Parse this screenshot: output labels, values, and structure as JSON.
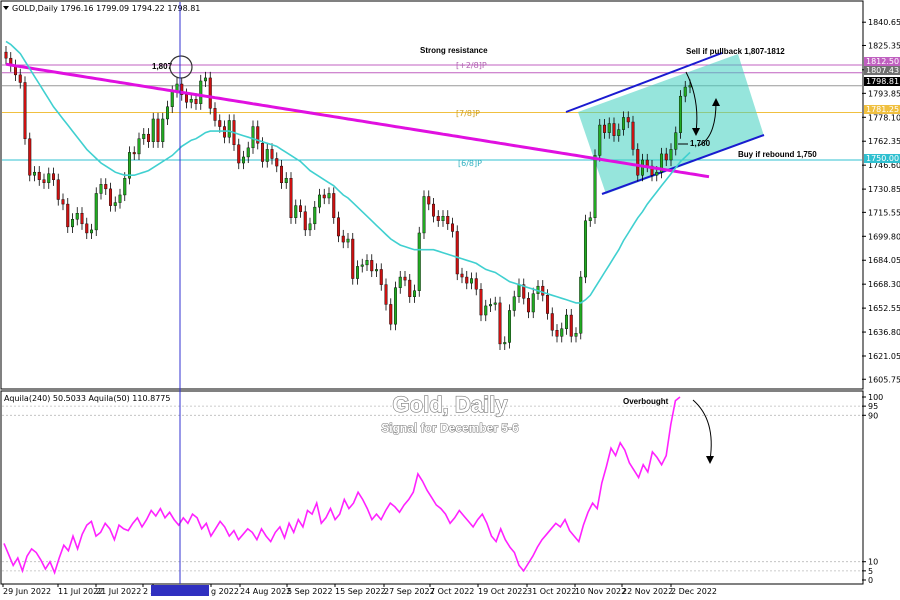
{
  "header": {
    "symbol_text": "GOLD,Daily  1796.16 1799.09 1794.22 1798.81"
  },
  "overlay": {
    "title": "Gold, Daily",
    "subtitle": "Signal for December 5-6"
  },
  "annotations": {
    "strong_resistance": "Strong resistance",
    "sell_note": "Sell if pullback 1,807-1812",
    "buy_note": "Buy if rebound 1,750",
    "level_1760": "1,760",
    "level_1807": "1,807",
    "overbought": "Overbought",
    "murray_top": "[+2/8]P",
    "murray_mid": "[7/8]P",
    "murray_low": "[6/8]P"
  },
  "price_tags": {
    "tag1": "1812.50",
    "tag2": "1807.43",
    "tag3": "1798.81",
    "tag4": "1781.25",
    "tag5": "1750.00"
  },
  "indicator": {
    "label": "Aquila(240) 50.5033  Aquila(50) 110.8775"
  },
  "colors": {
    "bull": "#22aa22",
    "bear": "#cc1111",
    "ma200": "#e010e0",
    "ma21": "#40d0d0",
    "channel": "#1a1ad0",
    "channel_fill": "#40d0c0",
    "oscillator": "#ff22ff"
  },
  "chart_data": [
    {
      "type": "candlestick",
      "title": "GOLD,Daily",
      "ylim": [
        1600,
        1850
      ],
      "y_ticks": [
        "1840.65",
        "1825.35",
        "1809.35",
        "1793.85",
        "1778.10",
        "1762.35",
        "1746.60",
        "1730.85",
        "1715.55",
        "1699.80",
        "1684.05",
        "1668.30",
        "1652.55",
        "1636.80",
        "1621.05",
        "1605.75"
      ],
      "x_tick_labels": [
        "29 Jun 2022",
        "11 Jul 2022",
        "21 Jul 2022",
        "2 Aug 2022",
        "2022.08.10 00:00",
        "g 2022",
        "24 Aug 2022",
        "5 Sep 2022",
        "15 Sep 2022",
        "27 Sep 2022",
        "7 Oct 2022",
        "19 Oct 2022",
        "31 Oct 2022",
        "10 Nov 2022",
        "22 Nov 2022",
        "2 Dec 2022"
      ],
      "close": [
        1817,
        1812,
        1806,
        1801,
        1764,
        1740,
        1742,
        1737,
        1735,
        1741,
        1737,
        1724,
        1721,
        1706,
        1711,
        1715,
        1708,
        1702,
        1704,
        1728,
        1734,
        1731,
        1720,
        1722,
        1727,
        1738,
        1755,
        1754,
        1764,
        1767,
        1762,
        1777,
        1762,
        1777,
        1785,
        1795,
        1800,
        1793,
        1788,
        1790,
        1787,
        1802,
        1804,
        1784,
        1776,
        1772,
        1765,
        1776,
        1760,
        1748,
        1752,
        1758,
        1772,
        1761,
        1749,
        1757,
        1751,
        1746,
        1735,
        1738,
        1712,
        1720,
        1716,
        1704,
        1708,
        1719,
        1727,
        1725,
        1728,
        1712,
        1700,
        1696,
        1698,
        1672,
        1680,
        1681,
        1684,
        1677,
        1678,
        1668,
        1655,
        1642,
        1666,
        1673,
        1671,
        1660,
        1664,
        1702,
        1726,
        1721,
        1713,
        1710,
        1713,
        1708,
        1703,
        1675,
        1673,
        1669,
        1672,
        1665,
        1648,
        1654,
        1655,
        1656,
        1629,
        1630,
        1651,
        1660,
        1668,
        1659,
        1650,
        1662,
        1667,
        1661,
        1649,
        1638,
        1634,
        1639,
        1648,
        1634,
        1636,
        1673,
        1710,
        1712,
        1753,
        1773,
        1768,
        1774,
        1766,
        1770,
        1778,
        1775,
        1757,
        1740,
        1750,
        1746,
        1740,
        1742,
        1754,
        1750,
        1757,
        1768,
        1792,
        1798,
        1799
      ],
      "ma200": [
        1813,
        1812.5,
        1812,
        1811.5,
        1811,
        1810.5,
        1810,
        1809.5,
        1809,
        1808.5,
        1808,
        1807.5,
        1807,
        1806.5,
        1806,
        1805.5,
        1805,
        1804.5,
        1804,
        1803.5,
        1803,
        1802.5,
        1802,
        1801.5,
        1801,
        1800.5,
        1800,
        1799.5,
        1799,
        1798.5,
        1798,
        1797.5,
        1797,
        1796.5,
        1796,
        1795.5,
        1795,
        1794.5,
        1794,
        1793.5,
        1793,
        1792.5,
        1792,
        1791.5,
        1791,
        1790.5,
        1790,
        1789.5,
        1789,
        1788.5,
        1788,
        1787.5,
        1787,
        1786.5,
        1786,
        1785.5,
        1785,
        1784.5,
        1784,
        1783.5,
        1783,
        1782.5,
        1782,
        1781.5,
        1781,
        1780.5,
        1780,
        1779.5,
        1779,
        1778.5,
        1778,
        1777.5,
        1777,
        1776.5,
        1776,
        1775.5,
        1775,
        1774.5,
        1774,
        1773.5,
        1773,
        1772.5,
        1772,
        1771.5,
        1771,
        1770.5,
        1770,
        1769.5,
        1769,
        1768.5,
        1768,
        1767.5,
        1767,
        1766.5,
        1766,
        1765.5,
        1765,
        1764.5,
        1764,
        1763.5,
        1763,
        1762.5,
        1762,
        1761.5,
        1761,
        1760.5,
        1760,
        1759.5,
        1759,
        1758.5,
        1758,
        1757.5,
        1757,
        1756.5,
        1756,
        1755.5,
        1755,
        1754.5,
        1754,
        1753.5,
        1753,
        1752.5,
        1752,
        1751.5,
        1751,
        1750.5,
        1750,
        1749.5,
        1749,
        1748.5,
        1748,
        1747.5,
        1747,
        1746.5,
        1746,
        1745.5,
        1745,
        1744.5,
        1744,
        1743.5,
        1743,
        1742.5,
        1742,
        1741.5,
        1741,
        1740.5,
        1740,
        1739.5,
        1739
      ],
      "ma21": [
        1828,
        1826,
        1823,
        1820,
        1815,
        1810,
        1805,
        1800,
        1795,
        1790,
        1785,
        1781,
        1777,
        1773,
        1769,
        1765,
        1761,
        1757,
        1754,
        1751,
        1748,
        1746,
        1744,
        1742,
        1741,
        1740,
        1740,
        1740,
        1741,
        1742,
        1743,
        1745,
        1747,
        1749,
        1751,
        1753,
        1756,
        1759,
        1761,
        1763,
        1764,
        1766,
        1768,
        1769,
        1769,
        1769,
        1769,
        1769,
        1768,
        1767,
        1766,
        1765,
        1764,
        1763,
        1762,
        1761,
        1760,
        1759,
        1757,
        1755,
        1753,
        1751,
        1749,
        1746,
        1743,
        1741,
        1739,
        1737,
        1735,
        1733,
        1730,
        1727,
        1725,
        1722,
        1719,
        1716,
        1713,
        1710,
        1707,
        1704,
        1701,
        1698,
        1696,
        1694,
        1693,
        1692,
        1691,
        1691,
        1691,
        1691,
        1691,
        1690,
        1689,
        1688,
        1687,
        1686,
        1685,
        1684,
        1683,
        1682,
        1680,
        1678,
        1677,
        1676,
        1674,
        1672,
        1670,
        1669,
        1668,
        1667,
        1666,
        1665,
        1664,
        1663,
        1662,
        1661,
        1660,
        1659,
        1658,
        1657,
        1656,
        1656,
        1658,
        1661,
        1666,
        1671,
        1676,
        1681,
        1686,
        1691,
        1697,
        1702,
        1707,
        1712,
        1716,
        1721,
        1725,
        1729,
        1733,
        1737,
        1741,
        1745,
        1749,
        1752,
        1755
      ]
    },
    {
      "type": "line",
      "title": "Aquila(240) 50.5033  Aquila(50) 110.8775",
      "ylim": [
        0,
        100
      ],
      "y_ticks": [
        "100",
        "95",
        "90",
        "10",
        "5",
        "0"
      ],
      "values": [
        20,
        14,
        8,
        12,
        5,
        13,
        17,
        15,
        11,
        6,
        10,
        4,
        12,
        19,
        16,
        24,
        17,
        25,
        30,
        32,
        24,
        26,
        31,
        28,
        22,
        30,
        28,
        27,
        31,
        34,
        29,
        33,
        38,
        35,
        39,
        34,
        37,
        33,
        30,
        34,
        31,
        36,
        34,
        28,
        31,
        24,
        28,
        32,
        29,
        24,
        27,
        22,
        25,
        28,
        26,
        22,
        28,
        24,
        21,
        26,
        29,
        23,
        31,
        26,
        33,
        29,
        38,
        36,
        42,
        31,
        34,
        39,
        33,
        36,
        44,
        39,
        42,
        48,
        44,
        39,
        33,
        36,
        33,
        38,
        42,
        40,
        37,
        41,
        44,
        48,
        58,
        54,
        49,
        45,
        41,
        39,
        36,
        31,
        34,
        38,
        35,
        32,
        29,
        33,
        36,
        31,
        24,
        21,
        28,
        22,
        18,
        15,
        8,
        5,
        9,
        13,
        18,
        22,
        25,
        28,
        31,
        29,
        33,
        27,
        24,
        21,
        30,
        37,
        42,
        39,
        53,
        62,
        72,
        68,
        75,
        71,
        64,
        60,
        56,
        63,
        59,
        70,
        67,
        63,
        68,
        85,
        98,
        100
      ]
    }
  ]
}
